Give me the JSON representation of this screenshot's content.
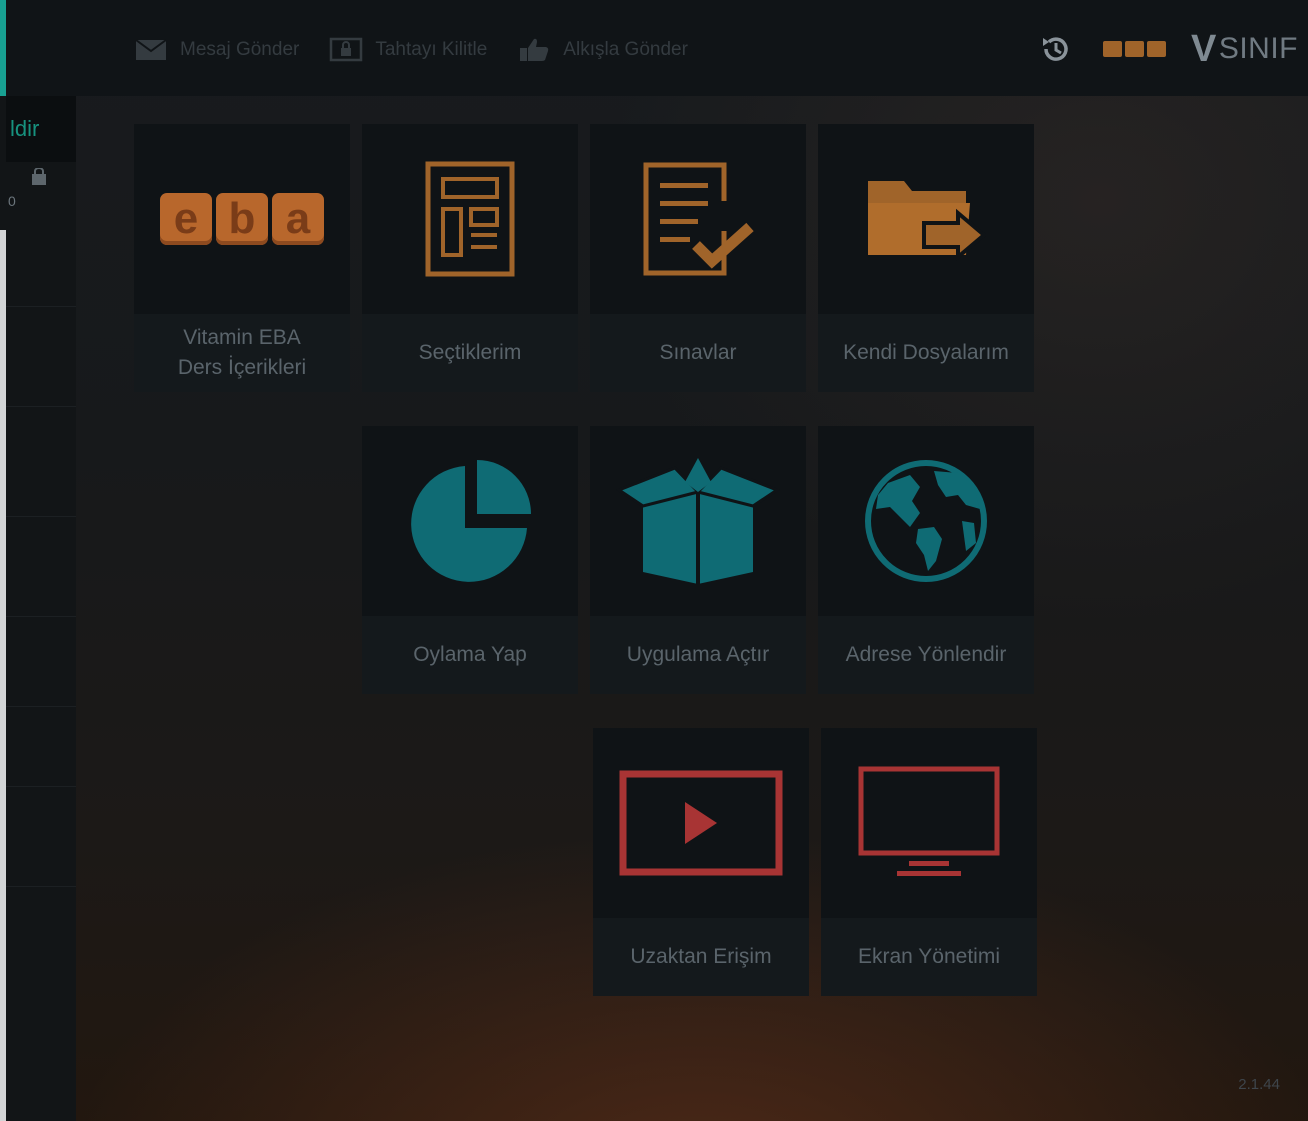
{
  "topbar": {
    "actions": [
      {
        "label": "Mesaj Gönder",
        "icon": "envelope-icon"
      },
      {
        "label": "Tahtayı Kilitle",
        "icon": "lock-screen-icon"
      },
      {
        "label": "Alkışla Gönder",
        "icon": "thumbs-up-icon"
      }
    ],
    "history_icon": "history-icon",
    "brand_text": "SINIF",
    "brand_letter": "V"
  },
  "sidebar": {
    "active_tab_label": "ldir",
    "mini_text": "0"
  },
  "tiles": [
    {
      "label": "Vitamin EBA\nDers İçerikleri",
      "icon": "eba-logo"
    },
    {
      "label": "Seçtiklerim",
      "icon": "document-layout-icon"
    },
    {
      "label": "Sınavlar",
      "icon": "checklist-icon"
    },
    {
      "label": "Kendi Dosyalarım",
      "icon": "folder-transfer-icon"
    },
    {
      "label": "Oylama Yap",
      "icon": "pie-chart-icon"
    },
    {
      "label": "Uygulama Açtır",
      "icon": "open-box-icon"
    },
    {
      "label": "Adrese Yönlendir",
      "icon": "globe-icon"
    },
    {
      "label": "Uzaktan Erişim",
      "icon": "play-screen-icon"
    },
    {
      "label": "Ekran Yönetimi",
      "icon": "monitor-icon"
    }
  ],
  "eba_letters": [
    "e",
    "b",
    "a"
  ],
  "version": "2.1.44",
  "colors": {
    "accent": "#18a192",
    "orange_icon": "#a0642a",
    "teal_icon": "#0f6b74",
    "red_icon": "#a83434"
  }
}
